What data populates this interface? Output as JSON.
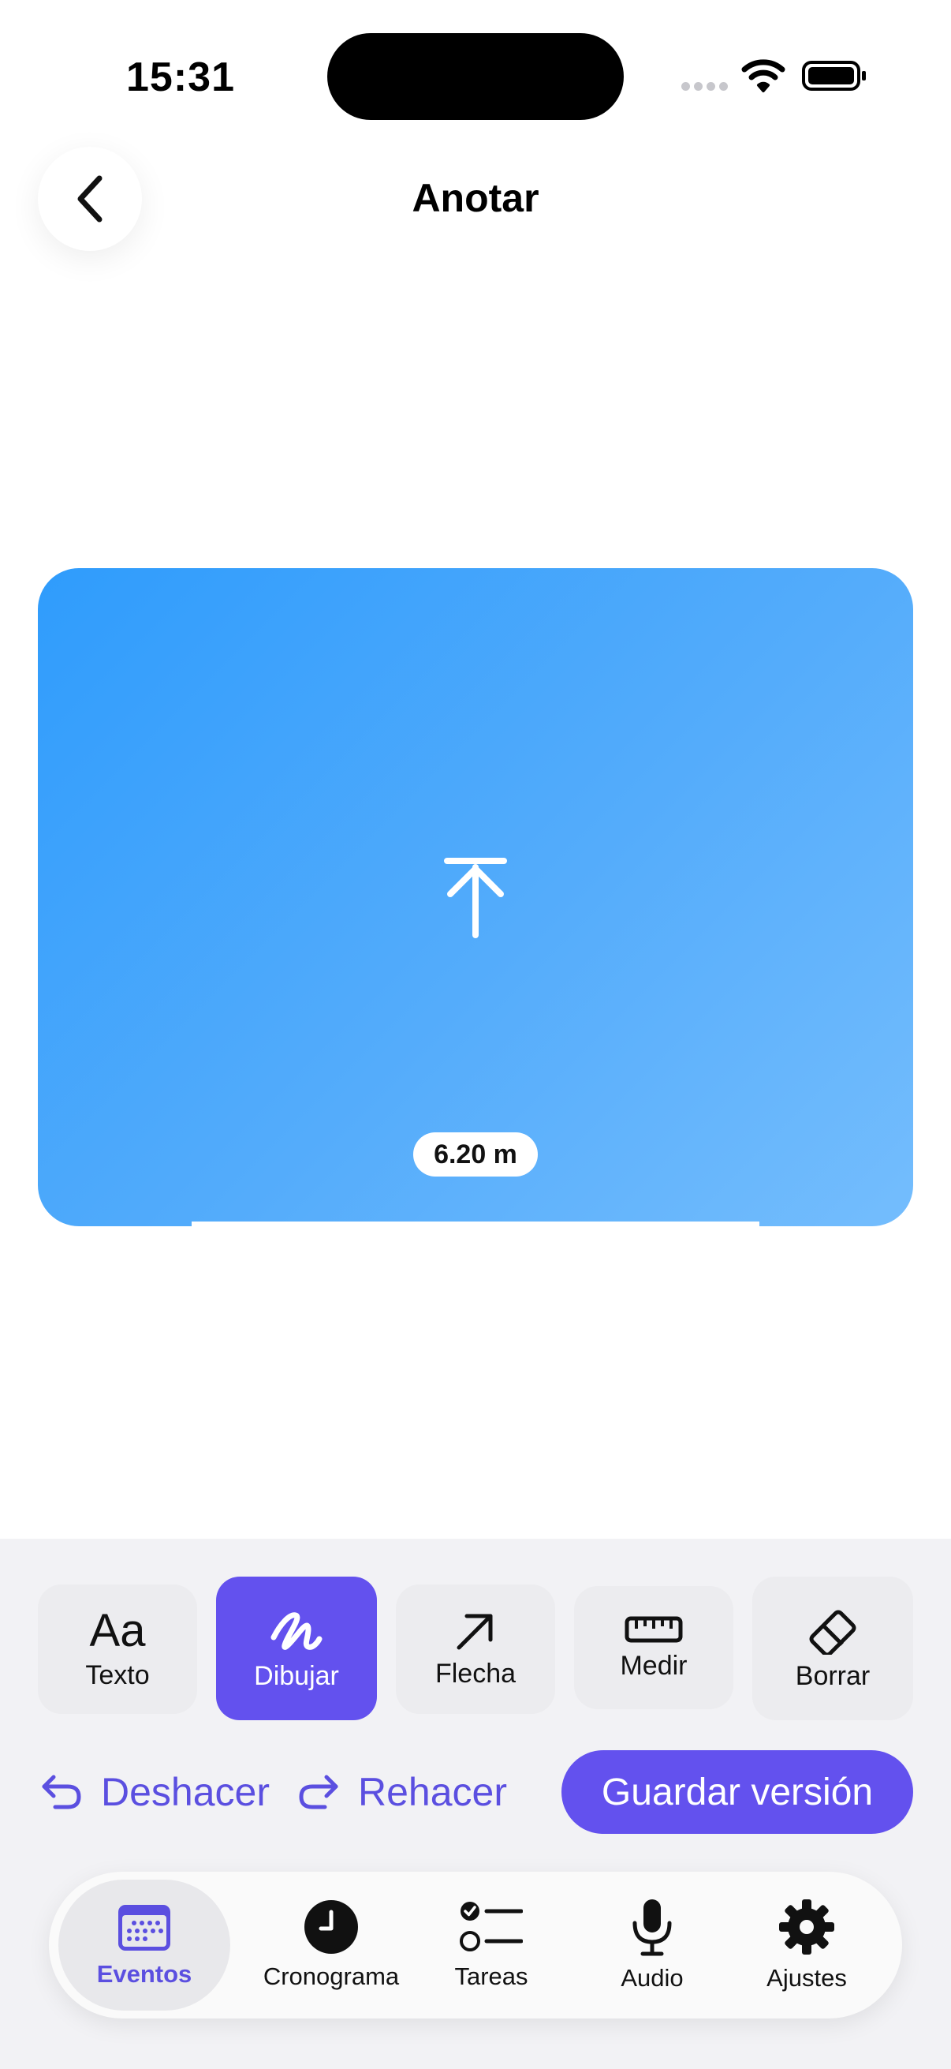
{
  "status_bar": {
    "time": "15:31"
  },
  "header": {
    "title": "Anotar",
    "back_icon": "chevron-left-icon"
  },
  "canvas": {
    "measurement": "6.20 m",
    "icon": "upload-arrow-icon",
    "gradient": [
      "#2f9cfc",
      "#74bdfd"
    ]
  },
  "tools": [
    {
      "label": "Texto",
      "icon": "text-aa-icon",
      "active": false
    },
    {
      "label": "Dibujar",
      "icon": "scribble-icon",
      "active": true
    },
    {
      "label": "Flecha",
      "icon": "arrow-up-right-icon",
      "active": false
    },
    {
      "label": "Medir",
      "icon": "ruler-icon",
      "active": false
    },
    {
      "label": "Borrar",
      "icon": "eraser-icon",
      "active": false
    }
  ],
  "tools_aa_glyph": "Aa",
  "actions": {
    "undo_label": "Deshacer",
    "redo_label": "Rehacer",
    "save_label": "Guardar versión"
  },
  "tabs": [
    {
      "label": "Eventos",
      "icon": "calendar-icon",
      "active": true
    },
    {
      "label": "Cronograma",
      "icon": "clock-icon",
      "active": false
    },
    {
      "label": "Tareas",
      "icon": "checklist-icon",
      "active": false
    },
    {
      "label": "Audio",
      "icon": "microphone-icon",
      "active": false
    },
    {
      "label": "Ajustes",
      "icon": "gear-icon",
      "active": false
    }
  ],
  "colors": {
    "accent": "#6351ee",
    "accent_text": "#5b4fe0",
    "panel_bg": "#f2f2f5"
  }
}
